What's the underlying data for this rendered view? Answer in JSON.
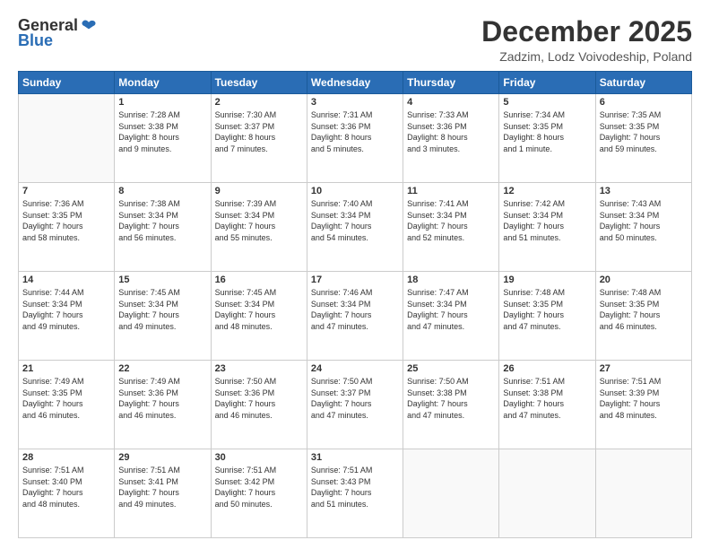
{
  "logo": {
    "general": "General",
    "blue": "Blue"
  },
  "title": "December 2025",
  "location": "Zadzim, Lodz Voivodeship, Poland",
  "headers": [
    "Sunday",
    "Monday",
    "Tuesday",
    "Wednesday",
    "Thursday",
    "Friday",
    "Saturday"
  ],
  "weeks": [
    [
      {
        "day": "",
        "info": ""
      },
      {
        "day": "1",
        "info": "Sunrise: 7:28 AM\nSunset: 3:38 PM\nDaylight: 8 hours\nand 9 minutes."
      },
      {
        "day": "2",
        "info": "Sunrise: 7:30 AM\nSunset: 3:37 PM\nDaylight: 8 hours\nand 7 minutes."
      },
      {
        "day": "3",
        "info": "Sunrise: 7:31 AM\nSunset: 3:36 PM\nDaylight: 8 hours\nand 5 minutes."
      },
      {
        "day": "4",
        "info": "Sunrise: 7:33 AM\nSunset: 3:36 PM\nDaylight: 8 hours\nand 3 minutes."
      },
      {
        "day": "5",
        "info": "Sunrise: 7:34 AM\nSunset: 3:35 PM\nDaylight: 8 hours\nand 1 minute."
      },
      {
        "day": "6",
        "info": "Sunrise: 7:35 AM\nSunset: 3:35 PM\nDaylight: 7 hours\nand 59 minutes."
      }
    ],
    [
      {
        "day": "7",
        "info": "Sunrise: 7:36 AM\nSunset: 3:35 PM\nDaylight: 7 hours\nand 58 minutes."
      },
      {
        "day": "8",
        "info": "Sunrise: 7:38 AM\nSunset: 3:34 PM\nDaylight: 7 hours\nand 56 minutes."
      },
      {
        "day": "9",
        "info": "Sunrise: 7:39 AM\nSunset: 3:34 PM\nDaylight: 7 hours\nand 55 minutes."
      },
      {
        "day": "10",
        "info": "Sunrise: 7:40 AM\nSunset: 3:34 PM\nDaylight: 7 hours\nand 54 minutes."
      },
      {
        "day": "11",
        "info": "Sunrise: 7:41 AM\nSunset: 3:34 PM\nDaylight: 7 hours\nand 52 minutes."
      },
      {
        "day": "12",
        "info": "Sunrise: 7:42 AM\nSunset: 3:34 PM\nDaylight: 7 hours\nand 51 minutes."
      },
      {
        "day": "13",
        "info": "Sunrise: 7:43 AM\nSunset: 3:34 PM\nDaylight: 7 hours\nand 50 minutes."
      }
    ],
    [
      {
        "day": "14",
        "info": "Sunrise: 7:44 AM\nSunset: 3:34 PM\nDaylight: 7 hours\nand 49 minutes."
      },
      {
        "day": "15",
        "info": "Sunrise: 7:45 AM\nSunset: 3:34 PM\nDaylight: 7 hours\nand 49 minutes."
      },
      {
        "day": "16",
        "info": "Sunrise: 7:45 AM\nSunset: 3:34 PM\nDaylight: 7 hours\nand 48 minutes."
      },
      {
        "day": "17",
        "info": "Sunrise: 7:46 AM\nSunset: 3:34 PM\nDaylight: 7 hours\nand 47 minutes."
      },
      {
        "day": "18",
        "info": "Sunrise: 7:47 AM\nSunset: 3:34 PM\nDaylight: 7 hours\nand 47 minutes."
      },
      {
        "day": "19",
        "info": "Sunrise: 7:48 AM\nSunset: 3:35 PM\nDaylight: 7 hours\nand 47 minutes."
      },
      {
        "day": "20",
        "info": "Sunrise: 7:48 AM\nSunset: 3:35 PM\nDaylight: 7 hours\nand 46 minutes."
      }
    ],
    [
      {
        "day": "21",
        "info": "Sunrise: 7:49 AM\nSunset: 3:35 PM\nDaylight: 7 hours\nand 46 minutes."
      },
      {
        "day": "22",
        "info": "Sunrise: 7:49 AM\nSunset: 3:36 PM\nDaylight: 7 hours\nand 46 minutes."
      },
      {
        "day": "23",
        "info": "Sunrise: 7:50 AM\nSunset: 3:36 PM\nDaylight: 7 hours\nand 46 minutes."
      },
      {
        "day": "24",
        "info": "Sunrise: 7:50 AM\nSunset: 3:37 PM\nDaylight: 7 hours\nand 47 minutes."
      },
      {
        "day": "25",
        "info": "Sunrise: 7:50 AM\nSunset: 3:38 PM\nDaylight: 7 hours\nand 47 minutes."
      },
      {
        "day": "26",
        "info": "Sunrise: 7:51 AM\nSunset: 3:38 PM\nDaylight: 7 hours\nand 47 minutes."
      },
      {
        "day": "27",
        "info": "Sunrise: 7:51 AM\nSunset: 3:39 PM\nDaylight: 7 hours\nand 48 minutes."
      }
    ],
    [
      {
        "day": "28",
        "info": "Sunrise: 7:51 AM\nSunset: 3:40 PM\nDaylight: 7 hours\nand 48 minutes."
      },
      {
        "day": "29",
        "info": "Sunrise: 7:51 AM\nSunset: 3:41 PM\nDaylight: 7 hours\nand 49 minutes."
      },
      {
        "day": "30",
        "info": "Sunrise: 7:51 AM\nSunset: 3:42 PM\nDaylight: 7 hours\nand 50 minutes."
      },
      {
        "day": "31",
        "info": "Sunrise: 7:51 AM\nSunset: 3:43 PM\nDaylight: 7 hours\nand 51 minutes."
      },
      {
        "day": "",
        "info": ""
      },
      {
        "day": "",
        "info": ""
      },
      {
        "day": "",
        "info": ""
      }
    ]
  ]
}
